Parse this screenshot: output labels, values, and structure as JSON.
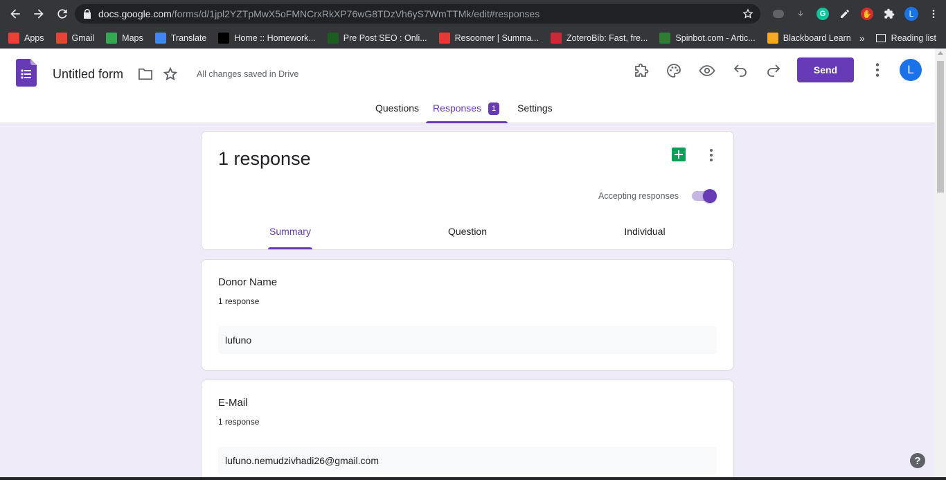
{
  "browser": {
    "url_host": "docs.google.com",
    "url_path": "/forms/d/1jpl2YZTpMwX5oFMNCrxRkXP76wG8TDzVh6yS7WmTTMk/edit#responses",
    "profile_initial": "L",
    "bookmarks": [
      {
        "label": "Apps",
        "icon": "apps-grid-icon",
        "color": "#ea4335"
      },
      {
        "label": "Gmail",
        "icon": "gmail-icon",
        "color": "#ea4335"
      },
      {
        "label": "Maps",
        "icon": "maps-pin-icon",
        "color": "#34a853"
      },
      {
        "label": "Translate",
        "icon": "translate-icon",
        "color": "#4285f4"
      },
      {
        "label": "Home :: Homework...",
        "icon": "homework-icon",
        "color": "#000000"
      },
      {
        "label": "Pre Post SEO : Onli...",
        "icon": "prepostseo-icon",
        "color": "#1b5e20"
      },
      {
        "label": "Resoomer | Summa...",
        "icon": "resoomer-icon",
        "color": "#e53935"
      },
      {
        "label": "ZoteroBib: Fast, fre...",
        "icon": "zotero-icon",
        "color": "#cc2936"
      },
      {
        "label": "Spinbot.com - Artic...",
        "icon": "spinbot-icon",
        "color": "#2e7d32"
      },
      {
        "label": "Blackboard Learn",
        "icon": "blackboard-icon",
        "color": "#f9a825"
      }
    ],
    "reading_list": "Reading list"
  },
  "app": {
    "form_title": "Untitled form",
    "save_status": "All changes saved in Drive",
    "send_label": "Send",
    "avatar_initial": "L",
    "accent_color": "#673ab7",
    "tabs": [
      {
        "label": "Questions",
        "active": false
      },
      {
        "label": "Responses",
        "active": true,
        "badge": "1"
      },
      {
        "label": "Settings",
        "active": false
      }
    ]
  },
  "summary": {
    "response_count": "1 response",
    "accepting_label": "Accepting responses",
    "accepting": true,
    "subtabs": [
      "Summary",
      "Question",
      "Individual"
    ]
  },
  "questions": [
    {
      "title": "Donor Name",
      "count": "1 response",
      "answer": "lufuno"
    },
    {
      "title": "E-Mail",
      "count": "1 response",
      "answer": "lufuno.nemudzivhadi26@gmail.com"
    }
  ]
}
